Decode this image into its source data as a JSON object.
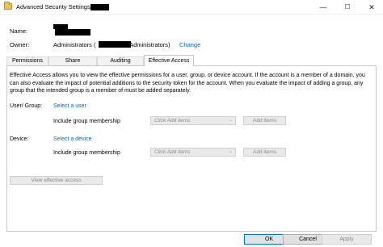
{
  "window": {
    "title": "Advanced Security Settings for",
    "minimize_glyph": "—",
    "maximize_glyph": "☐",
    "close_glyph": "✕"
  },
  "header": {
    "name_label": "Name:",
    "owner_label": "Owner:",
    "owner_value": "Administrators (",
    "owner_value_end": "\\Administrators)",
    "change_link": "Change"
  },
  "tabs": [
    {
      "label": "Permissions",
      "active": false
    },
    {
      "label": "Share",
      "active": false
    },
    {
      "label": "Auditing",
      "active": false
    },
    {
      "label": "Effective Access",
      "active": true
    }
  ],
  "main": {
    "description": "Effective Access allows you to view the effective permissions for a user, group, or device account. If the account is a member of a domain, you can also evaluate the impact of potential additions to the security token for the account. When you evaluate the impact of adding a group, any group that the intended group is a member of must be added separately.",
    "user_group": {
      "label": "User/ Group:",
      "select_link": "Select a user",
      "include_label": "Include group membership",
      "combo_placeholder": "Click Add items",
      "add_button": "Add items"
    },
    "device": {
      "label": "Device:",
      "select_link": "Select a device",
      "include_label": "Include group membership",
      "combo_placeholder": "Click Add items",
      "add_button": "Add items"
    },
    "view_button": "View effective access"
  },
  "footer": {
    "ok": "OK",
    "cancel": "Cancel",
    "apply": "Apply"
  },
  "colors": {
    "link": "#0066cc",
    "folder_icon": "#e8c25b",
    "ok_border": "#0078d7"
  }
}
